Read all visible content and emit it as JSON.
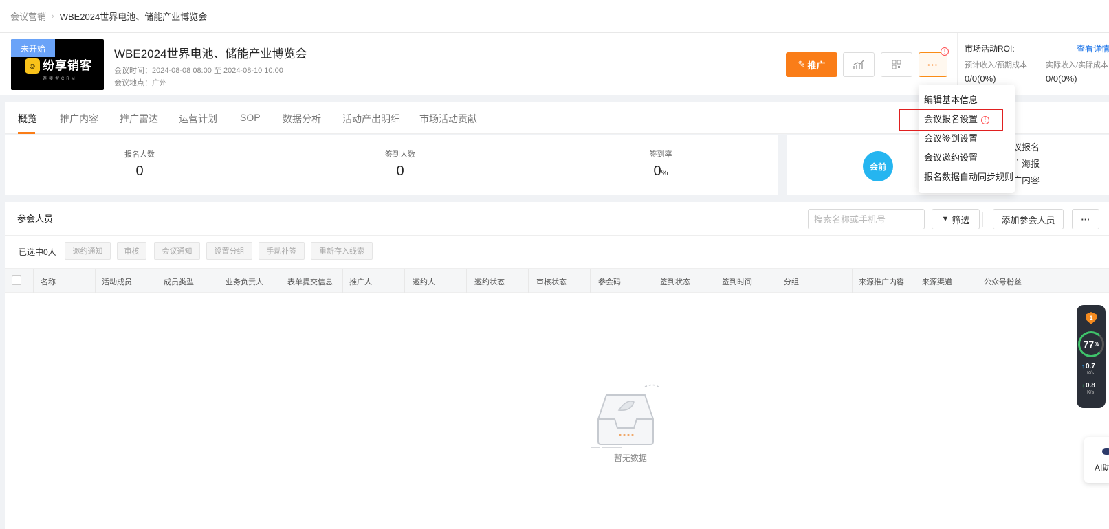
{
  "breadcrumb": {
    "parent": "会议营销",
    "separator": "›",
    "current": "WBE2024世界电池、储能产业博览会"
  },
  "header": {
    "status_tag": "未开始",
    "logo_text": "纷享销客",
    "logo_sub": "连接型CRM",
    "title": "WBE2024世界电池、储能产业博览会",
    "time": "会议时间：2024-08-08 08:00 至 2024-08-10 10:00",
    "place": "会议地点：广州",
    "promote_label": "推广",
    "more_label": "···",
    "warn_symbol": "!"
  },
  "roi": {
    "title": "市场活动ROI:",
    "link": "查看详情",
    "expected_label": "预计收入/预期成本",
    "expected_value": "0/0(0%)",
    "actual_label": "实际收入/实际成本",
    "actual_value": "0/0(0%)"
  },
  "tabs": [
    "概览",
    "推广内容",
    "推广雷达",
    "运营计划",
    "SOP",
    "数据分析",
    "活动产出明细",
    "市场活动贡献"
  ],
  "stats": [
    {
      "label": "报名人数",
      "value": "0",
      "unit": ""
    },
    {
      "label": "签到人数",
      "value": "0",
      "unit": ""
    },
    {
      "label": "签到率",
      "value": "0",
      "unit": "%"
    }
  ],
  "side": {
    "badge": "会前",
    "links": [
      "议报名",
      "广海报",
      "广内容"
    ]
  },
  "dropdown": {
    "items": [
      "编辑基本信息",
      "会议报名设置",
      "会议签到设置",
      "会议邀约设置",
      "报名数据自动同步规则"
    ]
  },
  "members": {
    "title": "参会人员",
    "search_placeholder": "搜索名称或手机号",
    "filter_label": "筛选",
    "add_label": "添加参会人员",
    "more_label": "···",
    "selected_text": "已选中0人",
    "bulk_actions": [
      "邀约通知",
      "审核",
      "会议通知",
      "设置分组",
      "手动补签",
      "重新存入线索"
    ],
    "columns": [
      "名称",
      "活动成员",
      "成员类型",
      "业务负责人",
      "表单提交信息",
      "推广人",
      "邀约人",
      "邀约状态",
      "审核状态",
      "参会码",
      "签到状态",
      "签到时间",
      "分组",
      "来源推广内容",
      "来源渠道",
      "公众号粉丝"
    ],
    "empty_text": "暂无数据"
  },
  "speed_widget": {
    "badge": "1",
    "percent": "77",
    "percent_unit": "%",
    "up": "0.7",
    "down": "0.8",
    "unit": "K/s"
  },
  "ai_widget": {
    "label": "AI助"
  },
  "colors": {
    "accent": "#fa7d18",
    "link": "#1a73e8",
    "badge_blue": "#25b5f0",
    "highlight": "#e02020"
  }
}
